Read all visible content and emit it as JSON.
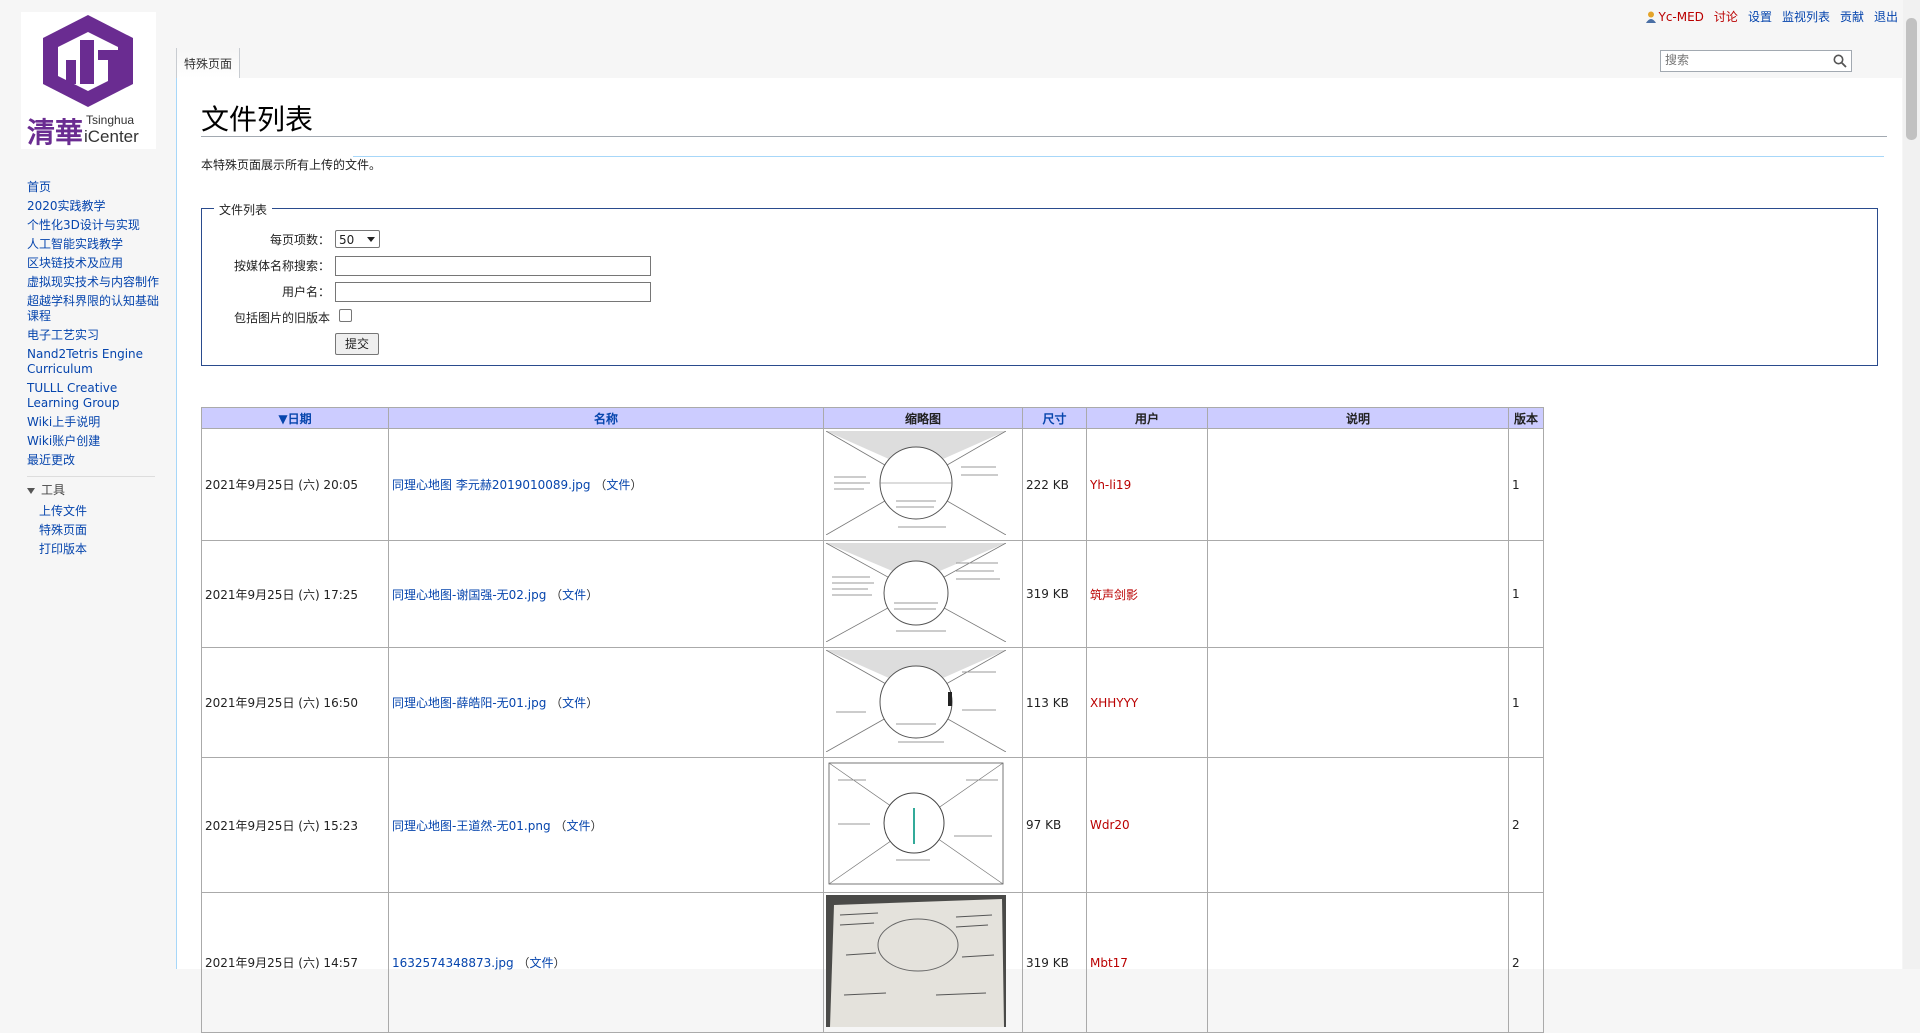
{
  "personal_tools": {
    "user": "Yc-MED",
    "talk": "讨论",
    "preferences": "设置",
    "watchlist": "监视列表",
    "contributions": "贡献",
    "logout": "退出"
  },
  "logo": {
    "line1": "Tsinghua",
    "line2": "iCenter",
    "brand_chars": "清華"
  },
  "sidebar": {
    "items": [
      {
        "label": "首页"
      },
      {
        "label": "2020实践教学"
      },
      {
        "label": "个性化3D设计与实现"
      },
      {
        "label": "人工智能实践教学"
      },
      {
        "label": "区块链技术及应用"
      },
      {
        "label": "虚拟现实技术与内容制作"
      },
      {
        "label": "超越学科界限的认知基础课程"
      },
      {
        "label": "电子工艺实习"
      },
      {
        "label": "Nand2Tetris Engine Curriculum"
      },
      {
        "label": "TULLL Creative Learning Group"
      },
      {
        "label": "Wiki上手说明"
      },
      {
        "label": "Wiki账户创建"
      },
      {
        "label": "最近更改"
      }
    ],
    "tools_heading": "工具",
    "tools": [
      {
        "label": "上传文件"
      },
      {
        "label": "特殊页面"
      },
      {
        "label": "打印版本"
      }
    ]
  },
  "tab": {
    "label": "特殊页面"
  },
  "search": {
    "placeholder": "搜索"
  },
  "page": {
    "title": "文件列表",
    "intro": "本特殊页面展示所有上传的文件。"
  },
  "form": {
    "legend": "文件列表",
    "limit_label": "每页项数：",
    "limit_value": "50",
    "media_search_label": "按媒体名称搜索：",
    "media_search_value": "",
    "user_label": "用户名：",
    "user_value": "",
    "old_versions_label": "包括图片的旧版本",
    "old_versions_checked": false,
    "submit_label": "提交"
  },
  "table": {
    "headers": {
      "date": "▼日期",
      "name": "名称",
      "thumb": "缩略图",
      "size": "尺寸",
      "user": "用户",
      "desc": "说明",
      "version": "版本"
    },
    "file_link_label": "文件",
    "rows": [
      {
        "date": "2021年9月25日 (六) 20:05",
        "name": "同理心地图 李元赫2019010089.jpg",
        "size": "222 KB",
        "user": "Yh-li19",
        "desc": "",
        "version": "1"
      },
      {
        "date": "2021年9月25日 (六) 17:25",
        "name": "同理心地图-谢国强-无02.jpg",
        "size": "319 KB",
        "user": "筑声剑影",
        "desc": "",
        "version": "1"
      },
      {
        "date": "2021年9月25日 (六) 16:50",
        "name": "同理心地图-薛皓阳-无01.jpg",
        "size": "113 KB",
        "user": "XHHYYY",
        "desc": "",
        "version": "1"
      },
      {
        "date": "2021年9月25日 (六) 15:23",
        "name": "同理心地图-王道然-无01.png",
        "size": "97 KB",
        "user": "Wdr20",
        "desc": "",
        "version": "2"
      },
      {
        "date": "2021年9月25日 (六) 14:57",
        "name": "1632574348873.jpg",
        "size": "319 KB",
        "user": "Mbt17",
        "desc": "",
        "version": "2"
      }
    ]
  },
  "colors": {
    "link": "#0645ad",
    "redlink": "#ba0000",
    "header_bg": "#ccccff",
    "logo_purple": "#6a2c91"
  }
}
